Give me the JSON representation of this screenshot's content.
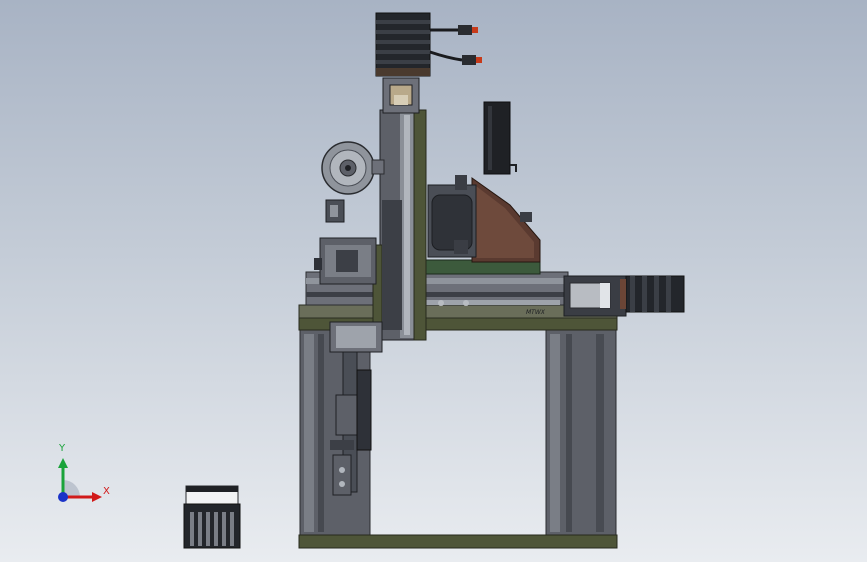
{
  "viewport": {
    "background_top": "#a8b3c4",
    "background_bottom": "#e9ecf0"
  },
  "model": {
    "rail_marking": "MTWX"
  },
  "triad": {
    "x_label": "X",
    "y_label": "Y",
    "x_color": "#d11a1a",
    "y_color": "#1aa33a",
    "z_color": "#1a33c8"
  },
  "colors": {
    "frame_olive": "#4e5538",
    "frame_grey": "#5d6068",
    "dark_metal": "#2e3138",
    "mid_metal": "#6d7079",
    "light_metal": "#9ea3ab",
    "brown_plate": "#5a3a30",
    "motor_black": "#23262b"
  }
}
